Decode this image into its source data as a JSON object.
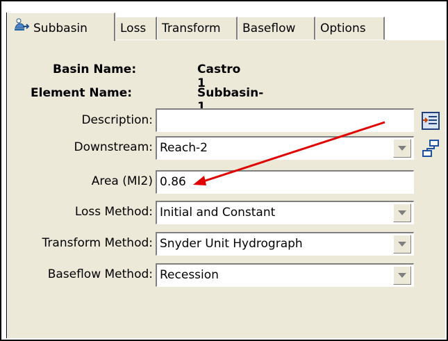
{
  "tabs": [
    {
      "label": "Subbasin",
      "active": true,
      "icon": "subbasin-icon"
    },
    {
      "label": "Loss"
    },
    {
      "label": "Transform"
    },
    {
      "label": "Baseflow"
    },
    {
      "label": "Options"
    }
  ],
  "basin": {
    "label": "Basin Name:",
    "value": "Castro 1"
  },
  "element": {
    "label": "Element Name:",
    "value": "Subbasin-1"
  },
  "fields": {
    "description": {
      "label": "Description:",
      "value": ""
    },
    "downstream": {
      "label": "Downstream:",
      "value": "Reach-2"
    },
    "area": {
      "label": "Area (MI2)",
      "value": "0.86"
    },
    "loss_method": {
      "label": "Loss Method:",
      "value": "Initial and Constant"
    },
    "transform_method": {
      "label": "Transform Method:",
      "value": "Snyder Unit Hydrograph"
    },
    "baseflow_method": {
      "label": "Baseflow Method:",
      "value": "Recession"
    }
  },
  "side_buttons": [
    "description-editor-icon",
    "downstream-select-icon"
  ],
  "annotation": {
    "type": "arrow",
    "color": "#e00000"
  },
  "colors": {
    "panel_bg": "#ece9d8",
    "field_bg": "#ffffff",
    "arrow": "#e00000"
  }
}
